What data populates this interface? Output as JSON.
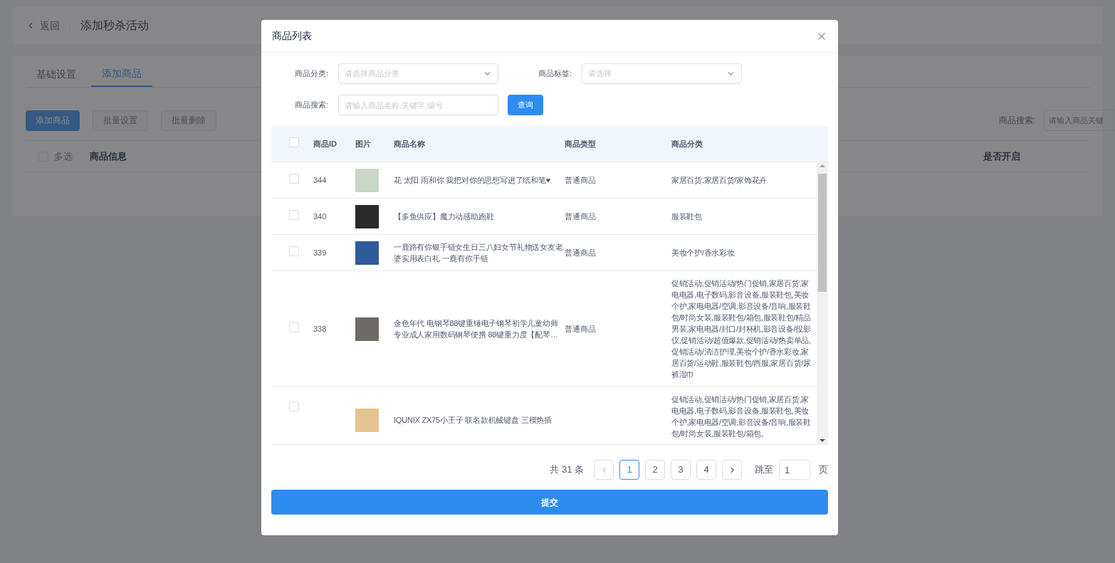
{
  "background_page": {
    "back_label": "返回",
    "title": "添加秒杀活动",
    "tabs": [
      {
        "label": "基础设置",
        "selected": false
      },
      {
        "label": "添加商品",
        "selected": true
      }
    ],
    "buttons": [
      {
        "label": "添加商品",
        "disabled": false
      },
      {
        "label": "批量设置",
        "disabled": true
      },
      {
        "label": "批量删除",
        "disabled": true
      }
    ],
    "search": {
      "label": "商品搜索:",
      "placeholder": "请输入商品关键"
    },
    "table": {
      "select_all": {
        "label": "多选",
        "checked": false
      },
      "columns": [
        "商品信息",
        "是否开启"
      ]
    }
  },
  "dialog": {
    "title": "商品列表",
    "filters": {
      "category": {
        "label": "商品分类:",
        "placeholder": "请选择商品分类"
      },
      "tag": {
        "label": "商品标签:",
        "placeholder": "请选择"
      },
      "search": {
        "label": "商品搜索:",
        "placeholder": "请输入商品名称,关键字,编号"
      },
      "query_button": "查询"
    },
    "table": {
      "select_all_checked": false,
      "columns": [
        "商品ID",
        "图片",
        "商品名称",
        "商品类型",
        "商品分类"
      ],
      "rows": [
        {
          "id": "344",
          "name": "花 太阳 雨和你 我把对你的思想写进了纸和笔♥",
          "type": "普通商品",
          "category": "家居百货,家居百货/家饰花卉",
          "checked": false
        },
        {
          "id": "340",
          "name": "【多鱼供应】魔力动感助跑鞋",
          "type": "普通商品",
          "category": "服装鞋包",
          "checked": false
        },
        {
          "id": "339",
          "name": "一鹿路有你银手链女生日三八妇女节礼物送女友老婆实用表白礼 一鹿有你手链",
          "type": "普通商品",
          "category": "美妆个护/香水彩妆",
          "checked": false
        },
        {
          "id": "338",
          "name": "金色年代 电钢琴88键重锤电子钢琴初学儿童幼师专业成人家用数码钢琴便携 88键重力度【配琴…",
          "type": "普通商品",
          "category": "促销活动,促销活动/热门促销,家居百货,家电电器,电子数码,影音设备,服装鞋包,美妆个护,家电电器/空调,影音设备/音响,服装鞋包/时尚女装,服装鞋包/箱包,服装鞋包/精品男装,家电电器/封口/封杯机,影音设备/投影仪,促销活动/超值爆款,促销活动/热卖单品,促销活动/清洁护理,美妆个护/香水彩妆,家居百货/运动鞋,服装鞋包/西服,家居百货/尿裤湿巾",
          "checked": false
        },
        {
          "name": "IQUNIX ZX75小王子 联名款机械键盘 三模热插",
          "category": "促销活动,促销活动/热门促销,家居百货,家电电器,电子数码,影音设备,服装鞋包,美妆个护,家电电器/空调,影音设备/音响,服装鞋包/时尚女装,服装鞋包/箱包,",
          "checked": false
        }
      ]
    },
    "pagination": {
      "total": "共 31 条",
      "pages": [
        {
          "label": "1",
          "selected": true
        },
        {
          "label": "2",
          "selected": false
        },
        {
          "label": "3",
          "selected": false
        },
        {
          "label": "4",
          "selected": false
        }
      ],
      "jump_label": "跳至",
      "jump_value": "1",
      "page_unit": "页"
    },
    "submit_button": "提交"
  }
}
